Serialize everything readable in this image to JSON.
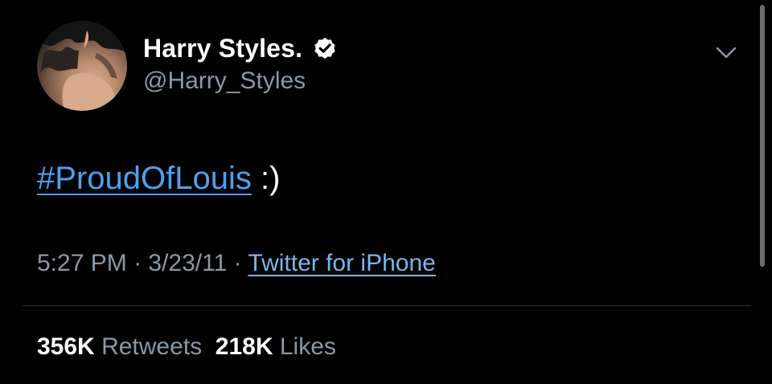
{
  "user": {
    "display_name": "Harry Styles.",
    "handle": "@Harry_Styles",
    "verified": true
  },
  "tweet": {
    "hashtag": "#ProudOfLouis",
    "text_rest": " :)",
    "time": "5:27 PM",
    "separator": " · ",
    "date": "3/23/11",
    "source": "Twitter for iPhone"
  },
  "stats": {
    "retweets_count": "356K",
    "retweets_label": "Retweets",
    "likes_count": "218K",
    "likes_label": "Likes"
  },
  "icons": {
    "verified": "verified-badge-icon",
    "menu": "chevron-down-icon"
  },
  "colors": {
    "background": "#000000",
    "text": "#ffffff",
    "secondary": "#8899a6",
    "link": "#4da0ef",
    "divider": "#2f3336"
  }
}
